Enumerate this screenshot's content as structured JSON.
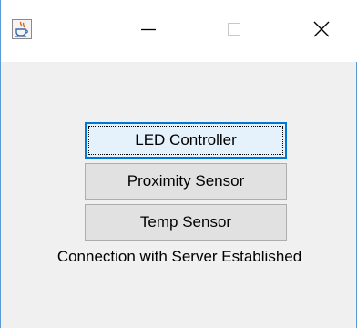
{
  "window": {
    "icon": "java-cup-icon",
    "controls": [
      "minimize-icon",
      "maximize-icon",
      "close-icon"
    ]
  },
  "buttons": {
    "led": "LED Controller",
    "proximity": "Proximity Sensor",
    "temp": "Temp Sensor"
  },
  "status": "Connection with Server Established",
  "colors": {
    "focus_border": "#0078d7",
    "button_bg": "#e1e1e1",
    "client_bg": "#f0f0f0"
  }
}
